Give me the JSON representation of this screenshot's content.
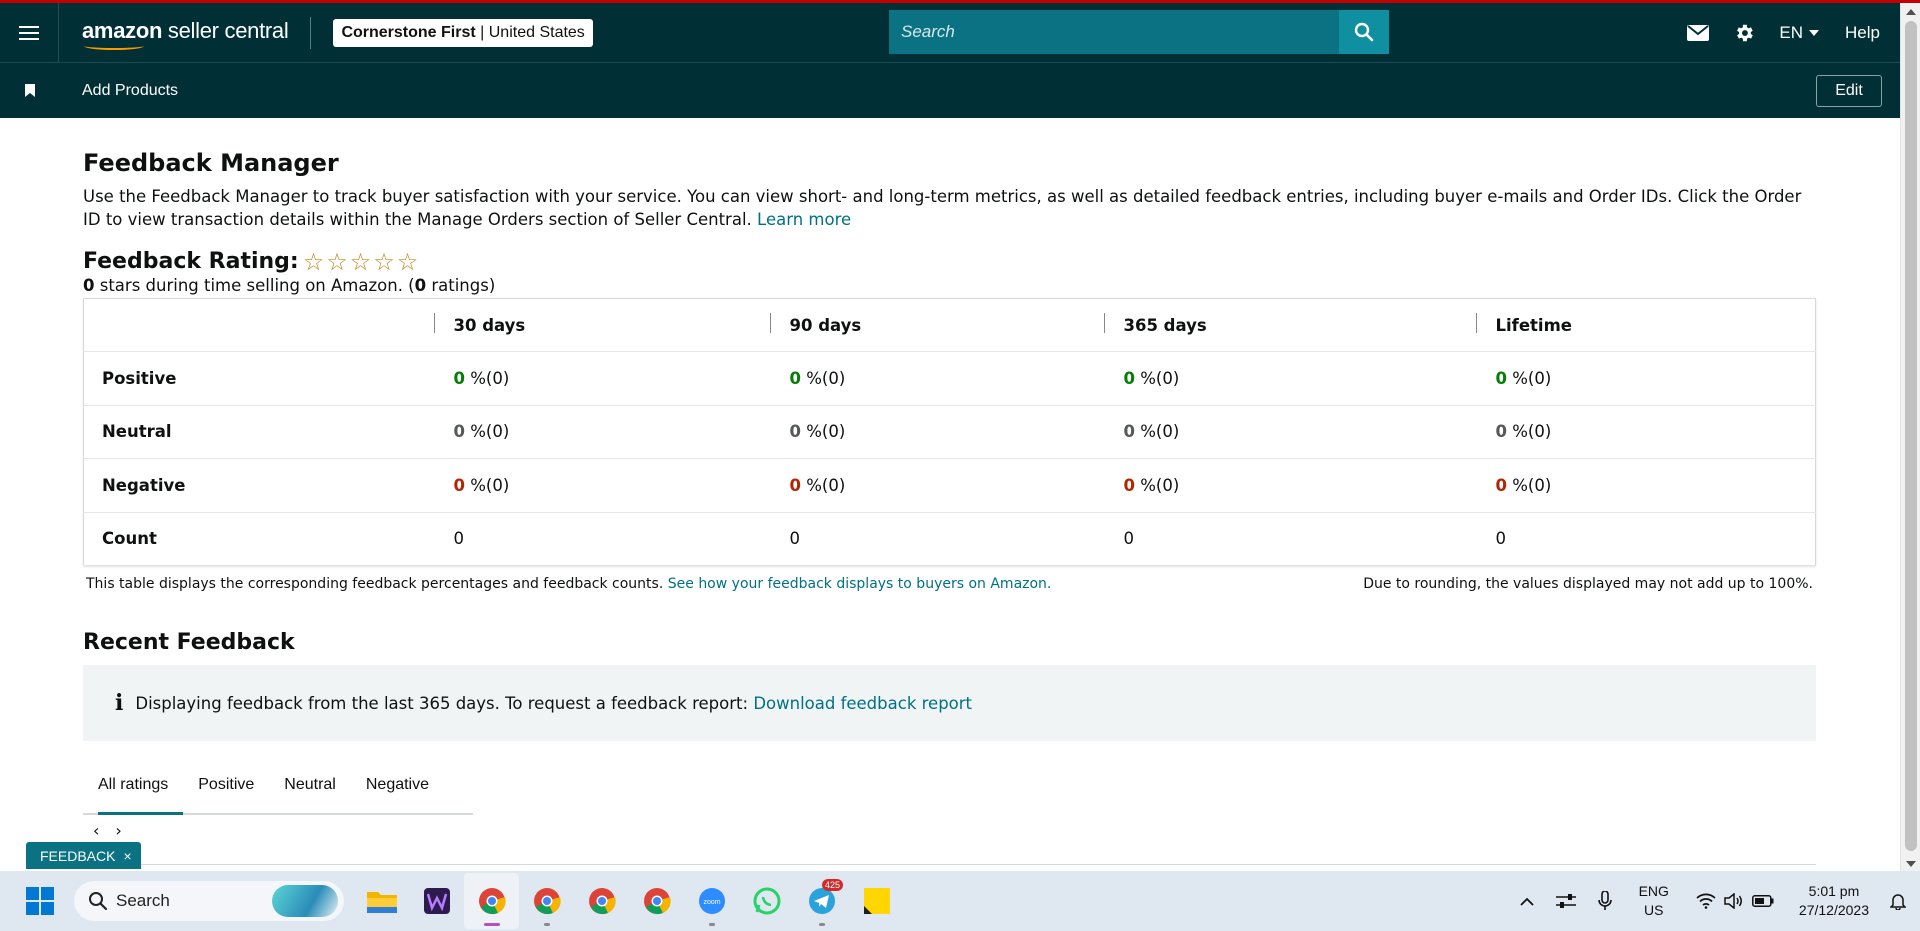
{
  "header": {
    "logo_text_bold": "amazon",
    "logo_text_rest": " seller central",
    "store_name": "Cornerstone First",
    "store_region": "United States",
    "search_placeholder": "Search",
    "language": "EN",
    "help": "Help"
  },
  "subbar": {
    "link": "Add Products",
    "edit": "Edit"
  },
  "main": {
    "title": "Feedback Manager",
    "description": "Use the Feedback Manager to track buyer satisfaction with your service. You can view short- and long-term metrics, as well as detailed feedback entries, including buyer e-mails and Order IDs. Click the Order ID to view transaction details within the Manage Orders section of Seller Central.",
    "learn_more": "Learn more",
    "rating_title": "Feedback Rating:",
    "stars_filled": 0,
    "stars_total": 5,
    "rating_stars_value": "0",
    "rating_sub_mid": " stars during time selling on Amazon. (",
    "rating_count_value": "0",
    "rating_sub_end": " ratings)"
  },
  "table": {
    "columns": [
      "30 days",
      "90 days",
      "365 days",
      "Lifetime"
    ],
    "rows": {
      "positive": {
        "label": "Positive",
        "values": [
          "0",
          "0",
          "0",
          "0"
        ],
        "suffix": " %(0)"
      },
      "neutral": {
        "label": "Neutral",
        "values": [
          "0",
          "0",
          "0",
          "0"
        ],
        "suffix": " %(0)"
      },
      "negative": {
        "label": "Negative",
        "values": [
          "0",
          "0",
          "0",
          "0"
        ],
        "suffix": " %(0)"
      },
      "count": {
        "label": "Count",
        "values": [
          "0",
          "0",
          "0",
          "0"
        ]
      }
    },
    "footer_left": "This table displays the corresponding feedback percentages and feedback counts.",
    "footer_link": "See how your feedback displays to buyers on Amazon.",
    "footer_right": "Due to rounding, the values displayed may not add up to 100%."
  },
  "recent": {
    "title": "Recent Feedback",
    "info_text": "Displaying feedback from the last 365 days. To request a feedback report:",
    "info_link": "Download feedback report",
    "tabs": [
      "All ratings",
      "Positive",
      "Neutral",
      "Negative"
    ],
    "active_tab": "All ratings",
    "pager_prev": "‹",
    "pager_next": "›"
  },
  "feedback_pill": {
    "label": "FEEDBACK",
    "close": "×"
  },
  "taskbar": {
    "search": "Search",
    "telegram_badge": "425",
    "zoom_label": "zoom",
    "lang_line1": "ENG",
    "lang_line2": "US",
    "time": "5:01 pm",
    "date": "27/12/2023"
  },
  "colors": {
    "header_bg": "#002f36",
    "search_bg": "#0a7282",
    "link": "#007185",
    "positive": "#067d06",
    "neutral": "#565959",
    "negative": "#b12704",
    "star": "#c7881a"
  }
}
